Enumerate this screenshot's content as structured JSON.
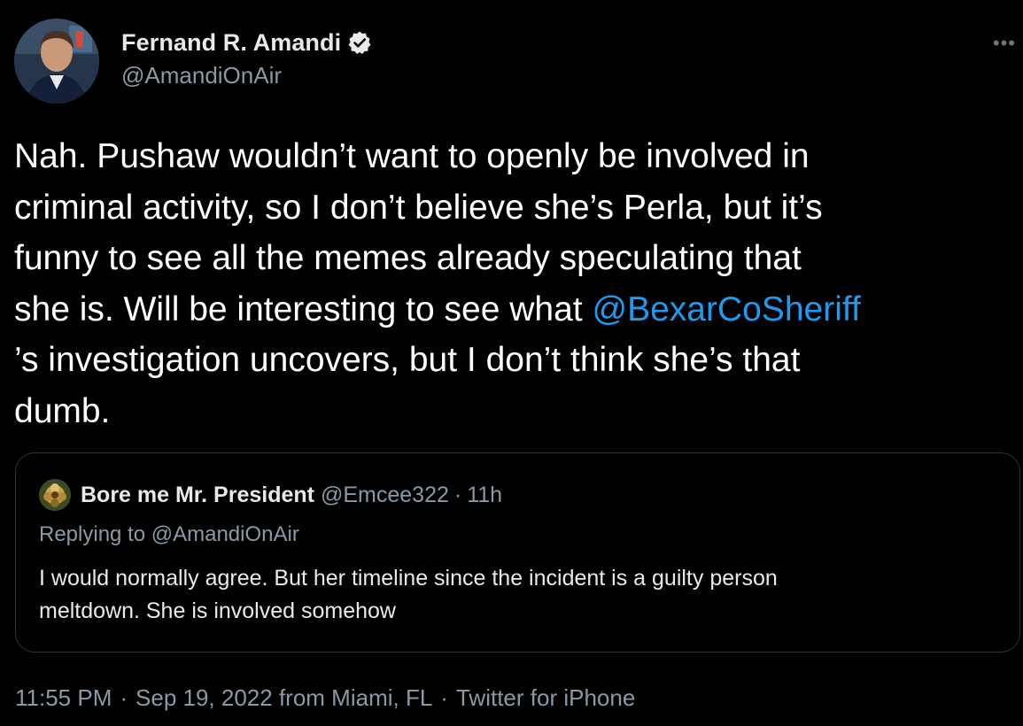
{
  "author": {
    "name": "Fernand R. Amandi",
    "handle": "@AmandiOnAir",
    "verified": true
  },
  "more_icon": "more-dots-icon",
  "tweet": {
    "lines": [
      {
        "text": "Nah. Pushaw wouldn’t want to openly be involved in"
      },
      {
        "text": "criminal activity, so I don’t believe she’s Perla, but it’s"
      },
      {
        "text": "funny to see all the memes already speculating that"
      },
      {
        "text": "she is. Will be interesting to see what ",
        "mention": "@BexarCoSheriff"
      },
      {
        "text": "’s investigation uncovers, but I don’t think she’s that"
      },
      {
        "text": "dumb."
      }
    ]
  },
  "quote": {
    "name": "Bore me Mr. President",
    "handle": "@Emcee322",
    "time": "11h",
    "dot": "·",
    "replying_prefix": "Replying to ",
    "replying_to": "@AmandiOnAir",
    "lines": [
      "I would normally agree. But her timeline since the incident is a guilty person",
      "meltdown. She is involved somehow"
    ]
  },
  "meta": {
    "time": "11:55 PM",
    "dot1": "·",
    "date_location": "Sep 19, 2022 from Miami, FL",
    "dot2": "·",
    "source": "Twitter for iPhone"
  },
  "colors": {
    "background": "#000000",
    "text": "#ffffff",
    "secondary": "#8b98a5",
    "link": "#1d9bf0",
    "border": "#2f3336"
  }
}
